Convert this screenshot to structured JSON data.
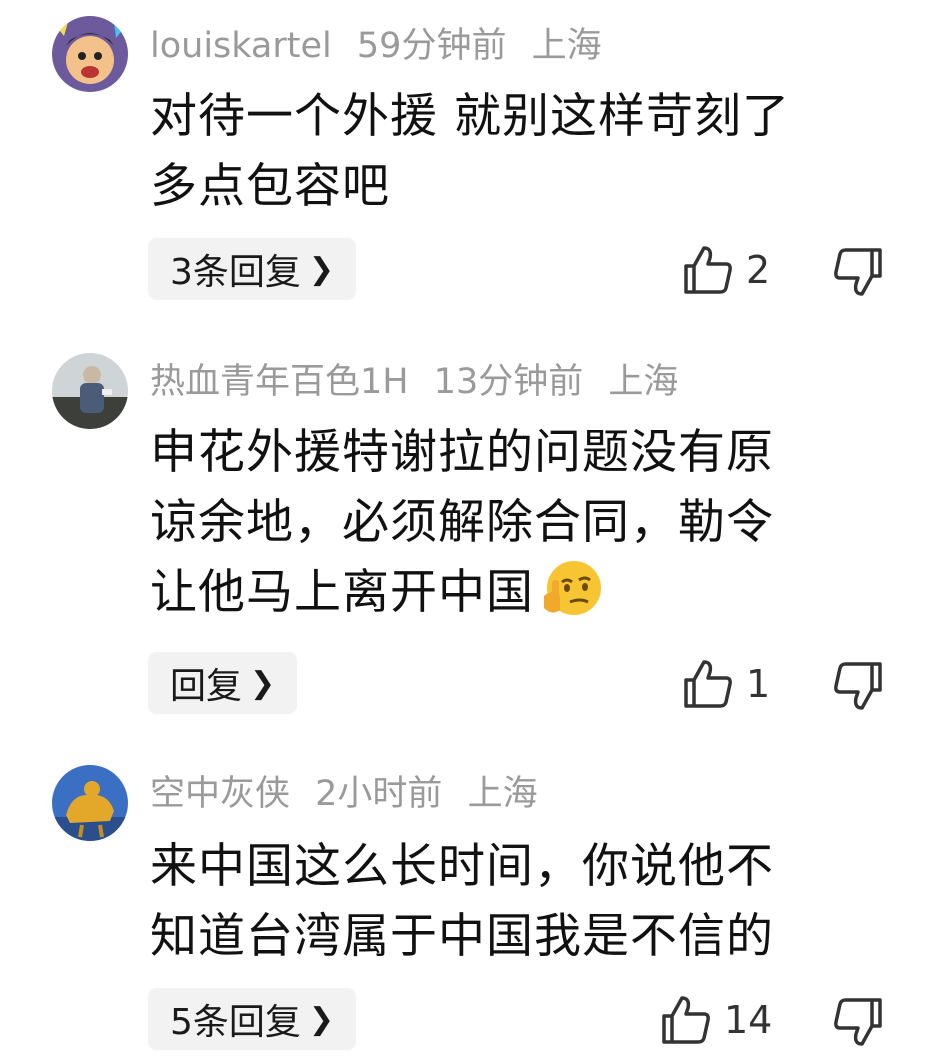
{
  "comments": [
    {
      "username": "louiskartel",
      "time": "59分钟前",
      "location": "上海",
      "lines": [
        "对待一个外援 就别这样苛刻了",
        "多点包容吧"
      ],
      "reply_label": "3条回复",
      "likes": "2",
      "avatar": "cartoon-face"
    },
    {
      "username": "热血青年百色1H",
      "time": "13分钟前",
      "location": "上海",
      "lines": [
        "申花外援特谢拉的问题没有原",
        "谅余地，必须解除合同，勒令",
        "让他马上离开中国"
      ],
      "reply_label": "回复",
      "likes": "1",
      "avatar": "person-photo",
      "emoji": "thinking-emoji"
    },
    {
      "username": "空中灰侠",
      "time": "2小时前",
      "location": "上海",
      "lines": [
        "来中国这么长时间，你说他不",
        "知道台湾属于中国我是不信的"
      ],
      "reply_label": "5条回复",
      "likes": "14",
      "avatar": "golden-statue"
    }
  ],
  "icons": {
    "like": "thumb-up-icon",
    "dislike": "thumb-down-icon",
    "chevron": "chevron-right-icon"
  }
}
